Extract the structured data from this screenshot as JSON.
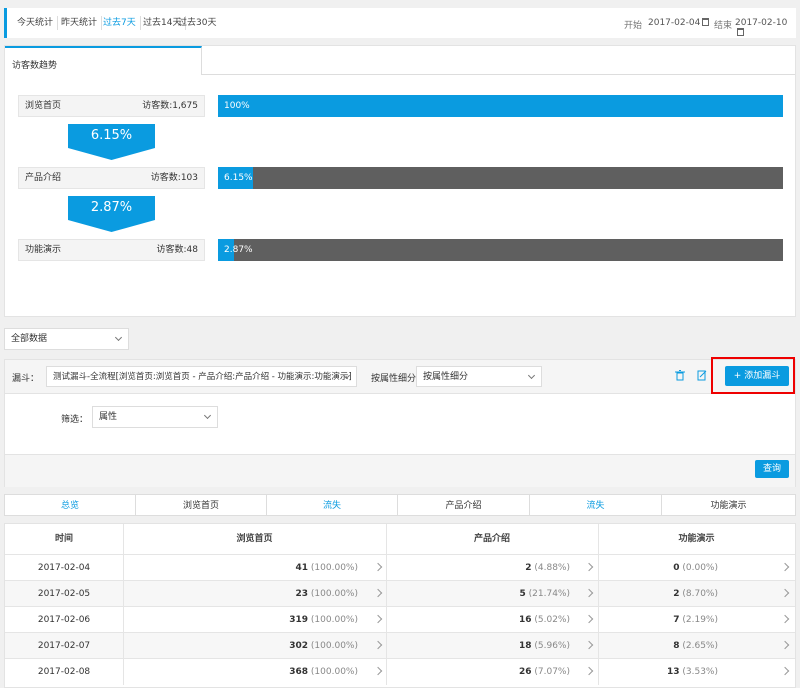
{
  "top": {
    "ranges": [
      "今天统计",
      "昨天统计",
      "过去7天",
      "过去14天",
      "过去30天"
    ],
    "active_range": 2,
    "start_label": "开始",
    "start_date": "2017-02-04",
    "end_label": "结束",
    "end_date": "2017-02-10"
  },
  "trend": {
    "tab": "访客数趋势",
    "steps": [
      {
        "name": "浏览首页",
        "count": "访客数:1,675",
        "bar_label": "100%",
        "fill": 1.0
      },
      {
        "name": "产品介绍",
        "count": "访客数:103",
        "bar_label": "6.15%",
        "fill": 0.0615
      },
      {
        "name": "功能演示",
        "count": "访客数:48",
        "bar_label": "2.87%",
        "fill": 0.0287
      }
    ],
    "conversions": [
      "6.15%",
      "2.87%"
    ]
  },
  "filter": {
    "all_data": "全部数据"
  },
  "funnel_cfg": {
    "funnel_label": "漏斗：",
    "funnel_value": "测试漏斗-全流程[浏览首页:浏览首页 - 产品介绍:产品介绍 - 功能演示:功能演示]",
    "group_label": "按属性细分：",
    "group_value": "按属性细分",
    "add_button": "+ 添加漏斗",
    "filter_label": "筛选：",
    "filter_value": "属性",
    "query_button": "查询"
  },
  "step_tabs": [
    "总览",
    "浏览首页",
    "流失",
    "产品介绍",
    "流失",
    "功能演示"
  ],
  "table": {
    "headers": [
      "时间",
      "浏览首页",
      "产品介绍",
      "功能演示"
    ],
    "rows": [
      {
        "date": "2017-02-04",
        "c1": "41",
        "p1": "(100.00%)",
        "c2": "2",
        "p2": "(4.88%)",
        "c3": "0",
        "p3": "(0.00%)"
      },
      {
        "date": "2017-02-05",
        "c1": "23",
        "p1": "(100.00%)",
        "c2": "5",
        "p2": "(21.74%)",
        "c3": "2",
        "p3": "(8.70%)"
      },
      {
        "date": "2017-02-06",
        "c1": "319",
        "p1": "(100.00%)",
        "c2": "16",
        "p2": "(5.02%)",
        "c3": "7",
        "p3": "(2.19%)"
      },
      {
        "date": "2017-02-07",
        "c1": "302",
        "p1": "(100.00%)",
        "c2": "18",
        "p2": "(5.96%)",
        "c3": "8",
        "p3": "(2.65%)"
      },
      {
        "date": "2017-02-08",
        "c1": "368",
        "p1": "(100.00%)",
        "c2": "26",
        "p2": "(7.07%)",
        "c3": "13",
        "p3": "(3.53%)"
      }
    ]
  },
  "colors": {
    "accent": "#0a9be0",
    "bar_track": "#5f5f5f",
    "highlight": "#e00000"
  }
}
